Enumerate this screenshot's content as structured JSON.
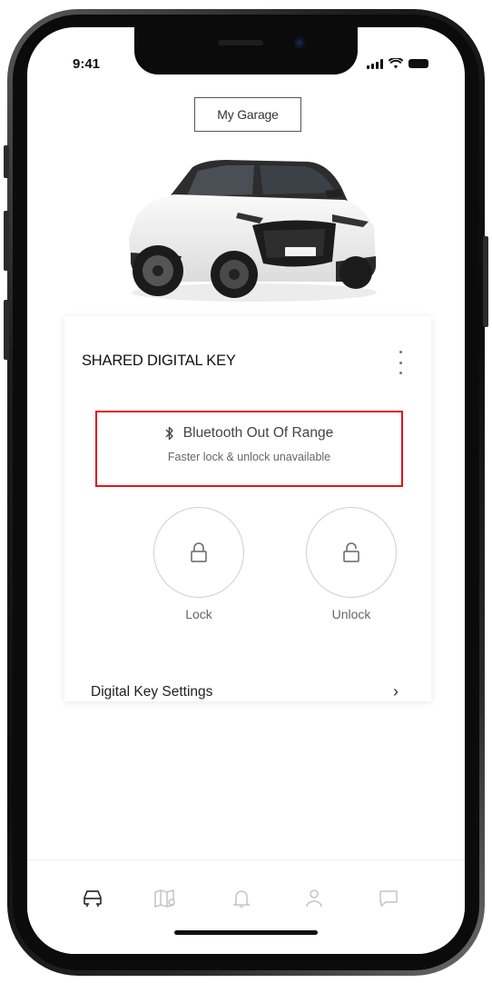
{
  "status_bar": {
    "time": "9:41"
  },
  "header": {
    "garage_label": "My Garage"
  },
  "card": {
    "title": "SHARED DIGITAL KEY",
    "bluetooth_status": "Bluetooth Out Of Range",
    "bluetooth_detail": "Faster lock & unlock unavailable",
    "lock_label": "Lock",
    "unlock_label": "Unlock",
    "settings_label": "Digital Key Settings"
  },
  "colors": {
    "highlight": "#e2131c",
    "text": "#222222",
    "muted": "#666666"
  },
  "tabs": [
    {
      "icon": "car-icon",
      "active": true
    },
    {
      "icon": "map-icon",
      "active": false
    },
    {
      "icon": "bell-icon",
      "active": false
    },
    {
      "icon": "profile-icon",
      "active": false
    },
    {
      "icon": "chat-icon",
      "active": false
    }
  ]
}
